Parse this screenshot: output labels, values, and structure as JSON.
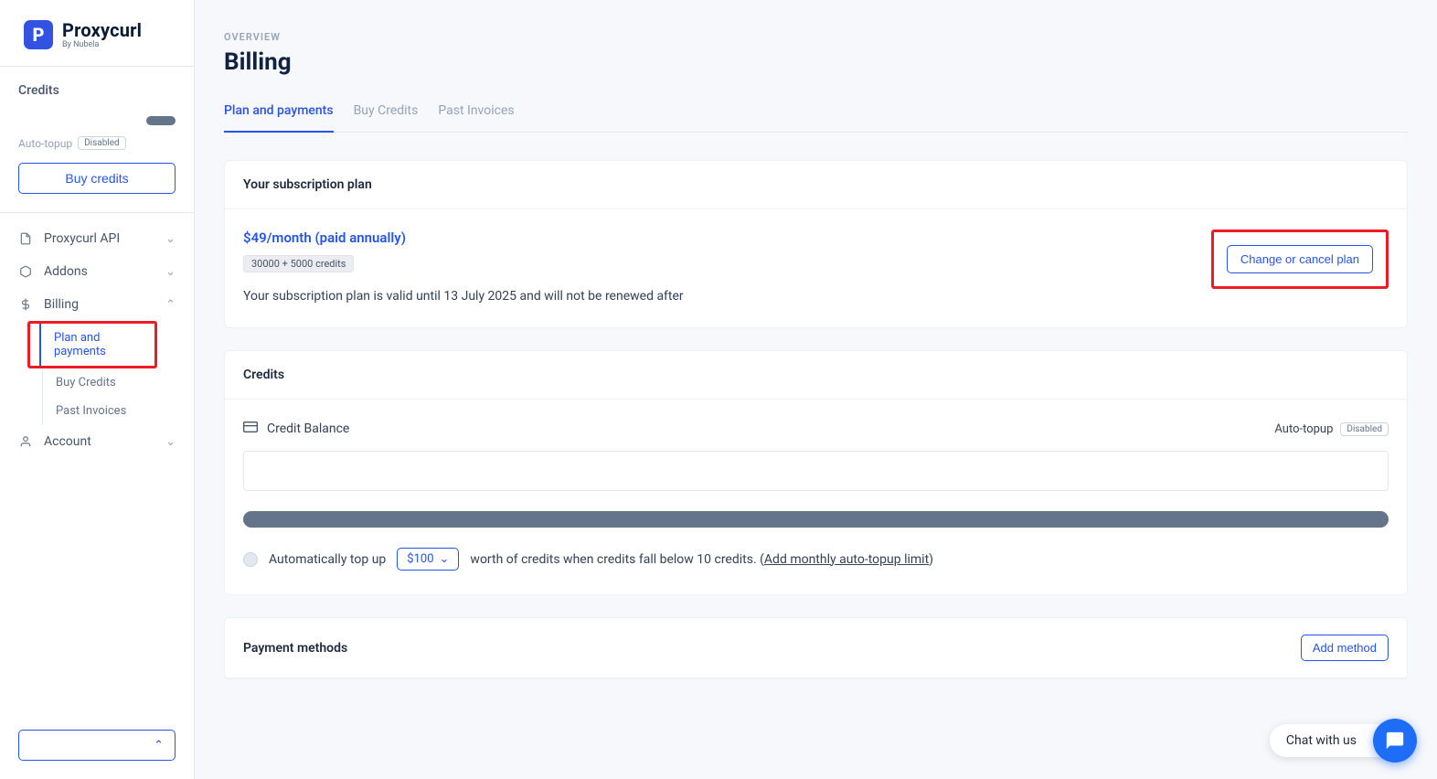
{
  "brand": {
    "name": "Proxycurl",
    "tagline": "By Nubela",
    "mark": "P"
  },
  "sidebar": {
    "credits_label": "Credits",
    "auto_topup_label": "Auto-topup",
    "auto_topup_status": "Disabled",
    "buy_credits_btn": "Buy credits",
    "nav": {
      "proxycurl_api": "Proxycurl API",
      "addons": "Addons",
      "billing": "Billing",
      "account": "Account"
    },
    "billing_sub": {
      "plan_payments": "Plan and payments",
      "buy_credits": "Buy Credits",
      "past_invoices": "Past Invoices"
    }
  },
  "page": {
    "overview_label": "OVERVIEW",
    "title": "Billing",
    "tabs": {
      "plan": "Plan and payments",
      "buy": "Buy Credits",
      "invoices": "Past Invoices"
    },
    "subscription": {
      "header": "Your subscription plan",
      "price": "$49/month (paid annually)",
      "credits_chip": "30000 + 5000 credits",
      "valid_text": "Your subscription plan is valid until 13 July 2025 and will not be renewed after",
      "change_btn": "Change or cancel plan"
    },
    "credits_card": {
      "header": "Credits",
      "balance_label": "Credit Balance",
      "auto_topup_label": "Auto-topup",
      "auto_topup_status": "Disabled",
      "topup_prefix": "Automatically top up",
      "topup_amount": "$100",
      "topup_suffix": "worth of credits when credits fall below 10 credits. (",
      "topup_link": "Add monthly auto-topup limit",
      "topup_close": ")"
    },
    "payment_methods": {
      "header": "Payment methods",
      "add_btn": "Add method"
    }
  },
  "chat": {
    "text": "Chat with us"
  }
}
